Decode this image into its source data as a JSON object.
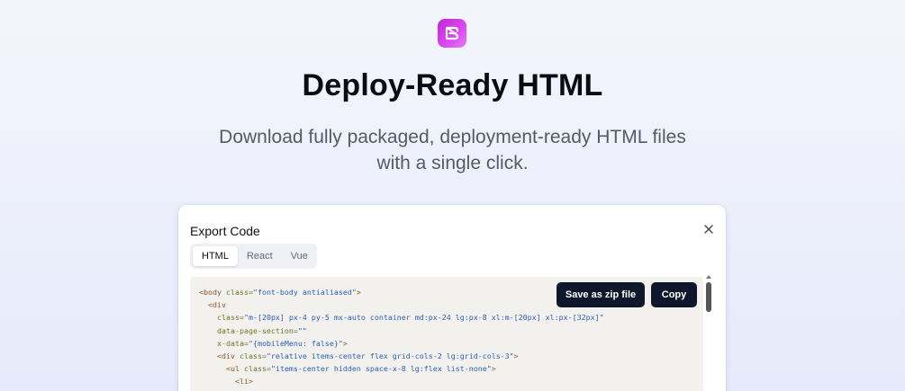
{
  "hero": {
    "logo_icon": "brand-logo-e-icon",
    "title": "Deploy-Ready HTML",
    "subtitle": "Download fully packaged, deployment-ready HTML files with a single click."
  },
  "colors": {
    "brand": "#d946ef",
    "button": "#0f172a",
    "code_bg": "#f3f1ee"
  },
  "modal": {
    "title": "Export Code",
    "close_icon": "close-icon",
    "tabs": [
      {
        "label": "HTML",
        "active": true
      },
      {
        "label": "React",
        "active": false
      },
      {
        "label": "Vue",
        "active": false
      }
    ],
    "save_label": "Save as zip file",
    "copy_label": "Copy",
    "code_lines": [
      {
        "indent": "",
        "tag": "<body",
        "attr": " class=",
        "str": "\"font-body antialiased\"",
        "end": ">"
      },
      {
        "indent": "  ",
        "tag": "<div",
        "attr": "",
        "str": "",
        "end": ""
      },
      {
        "indent": "    ",
        "tag": "",
        "attr": "class=",
        "str": "\"m-[20px] px-4 py-5 mx-auto container md:px-24 lg:px-8 xl:m-[20px] xl:px-[32px]\"",
        "end": ""
      },
      {
        "indent": "    ",
        "tag": "",
        "attr": "data-page-section=",
        "str": "\"\"",
        "end": ""
      },
      {
        "indent": "    ",
        "tag": "",
        "attr": "x-data=",
        "str": "\"{mobileMenu: false}\"",
        "end": ">"
      },
      {
        "indent": "    ",
        "tag": "<div",
        "attr": " class=",
        "str": "\"relative items-center flex grid-cols-2 lg:grid-cols-3\"",
        "end": ">"
      },
      {
        "indent": "      ",
        "tag": "<ul",
        "attr": " class=",
        "str": "\"items-center hidden space-x-8 lg:flex list-none\"",
        "end": ">"
      },
      {
        "indent": "        ",
        "tag": "<li>",
        "attr": "",
        "str": "",
        "end": ""
      }
    ]
  }
}
